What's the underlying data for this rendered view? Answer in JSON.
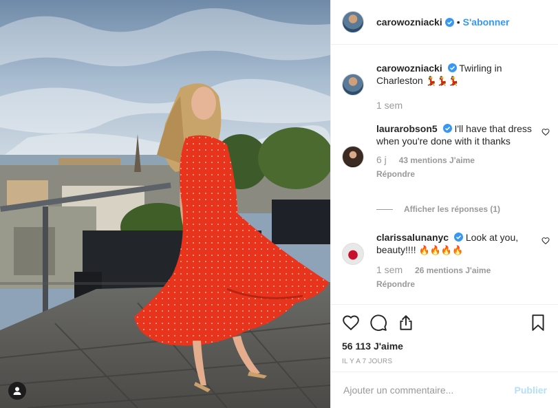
{
  "post": {
    "photo_alt": "",
    "author": {
      "username": "carowozniacki",
      "verified": true
    },
    "follow_label": "S'abonner",
    "caption": {
      "username": "carowozniacki",
      "text": "Twirling in Charleston",
      "emoji": "💃💃💃",
      "time": "1 sem"
    },
    "comments": [
      {
        "username": "laurarobson5",
        "verified": true,
        "text": "I'll have that dress when you're done with it thanks",
        "time": "6 j",
        "likes": "43 mentions J'aime",
        "reply_label": "Répondre"
      },
      {
        "username": "clarissalunanyc",
        "verified": true,
        "text": "Look at you, beauty!!!!",
        "emoji": "🔥🔥🔥🔥",
        "time": "1 sem",
        "likes": "26 mentions J'aime",
        "reply_label": "Répondre"
      }
    ],
    "view_replies_label": "Afficher les réponses (1)",
    "likes_count": "56 113 J'aime",
    "posted_ago": "IL Y A 7 JOURS",
    "comment_placeholder": "Ajouter un commentaire...",
    "publish_label": "Publier"
  },
  "colors": {
    "accent": "#3897f0",
    "verified": "#3897f0",
    "dress": "#e8341c",
    "publish_disabled": "#b2dffc"
  },
  "icons": {
    "like": "heart-icon",
    "comment": "comment-icon",
    "share": "share-icon",
    "save": "bookmark-icon",
    "user_tag": "user-icon"
  }
}
